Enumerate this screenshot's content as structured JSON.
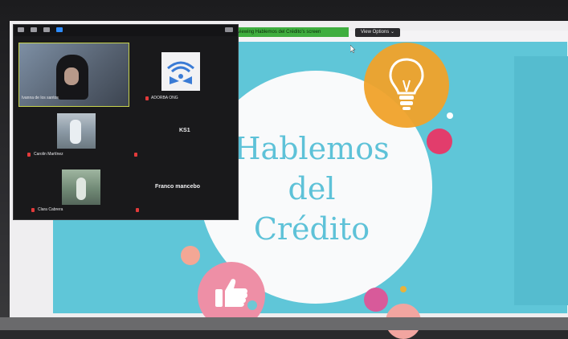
{
  "zoom": {
    "share_banner": "You are viewing Hablemos del Crédito's screen",
    "view_options": "View Options ⌄"
  },
  "slide": {
    "title_line1": "Hablemos",
    "title_line2": "del",
    "title_line3": "Crédito"
  },
  "participants": [
    {
      "name": "Ivanna de los santos"
    },
    {
      "name": "ADORBA ONG"
    },
    {
      "name": "KS1"
    },
    {
      "name": "Carolin Martínez"
    },
    {
      "name": "Franco mancebo"
    },
    {
      "name": "Clara Cabrera"
    }
  ],
  "colors": {
    "slide_bg": "#5fc6d8",
    "title": "#5ec2d8",
    "bulb": "#f0a22a",
    "accent_pink": "#e23d6c",
    "active_speaker": "#c8d44e"
  }
}
